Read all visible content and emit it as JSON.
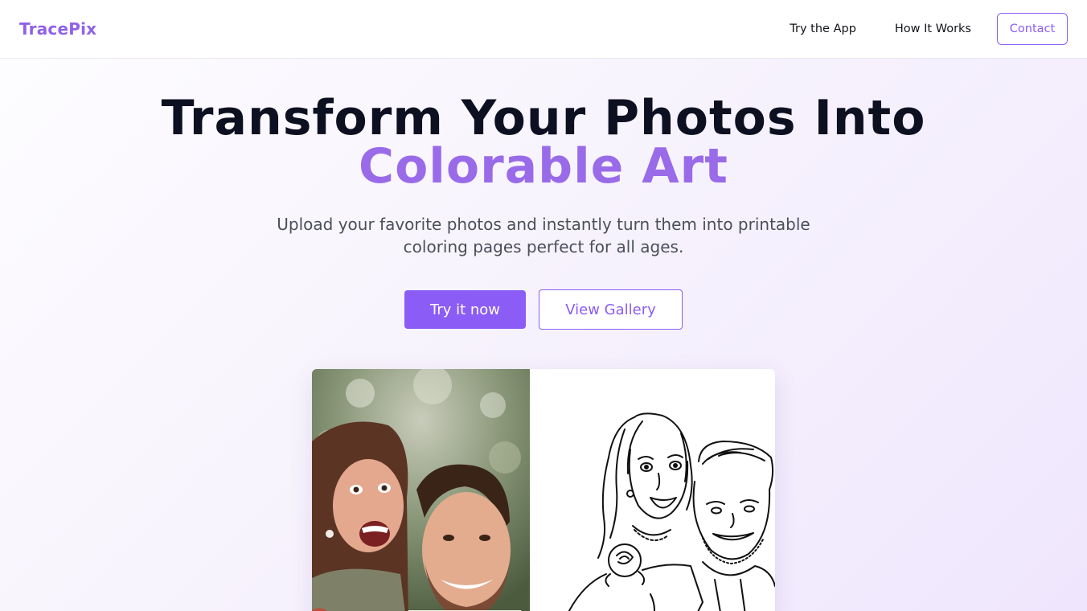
{
  "nav": {
    "logo": "TracePix",
    "links": [
      {
        "label": "Try the App"
      },
      {
        "label": "How It Works"
      }
    ],
    "contact_label": "Contact"
  },
  "hero": {
    "headline_line1": "Transform Your Photos Into",
    "headline_accent": "Colorable Art",
    "subtitle": "Upload your favorite photos and instantly turn them into printable coloring pages perfect for all ages.",
    "primary_cta": "Try it now",
    "secondary_cta": "View Gallery"
  },
  "colors": {
    "brand": "#8b5cf6",
    "accent_text": "#9a6be9",
    "headline_text": "#0d1020",
    "body_text": "#4a4f5c"
  },
  "showcase": {
    "before_image": "couple-photo",
    "after_image": "couple-coloring-page-line-art"
  }
}
